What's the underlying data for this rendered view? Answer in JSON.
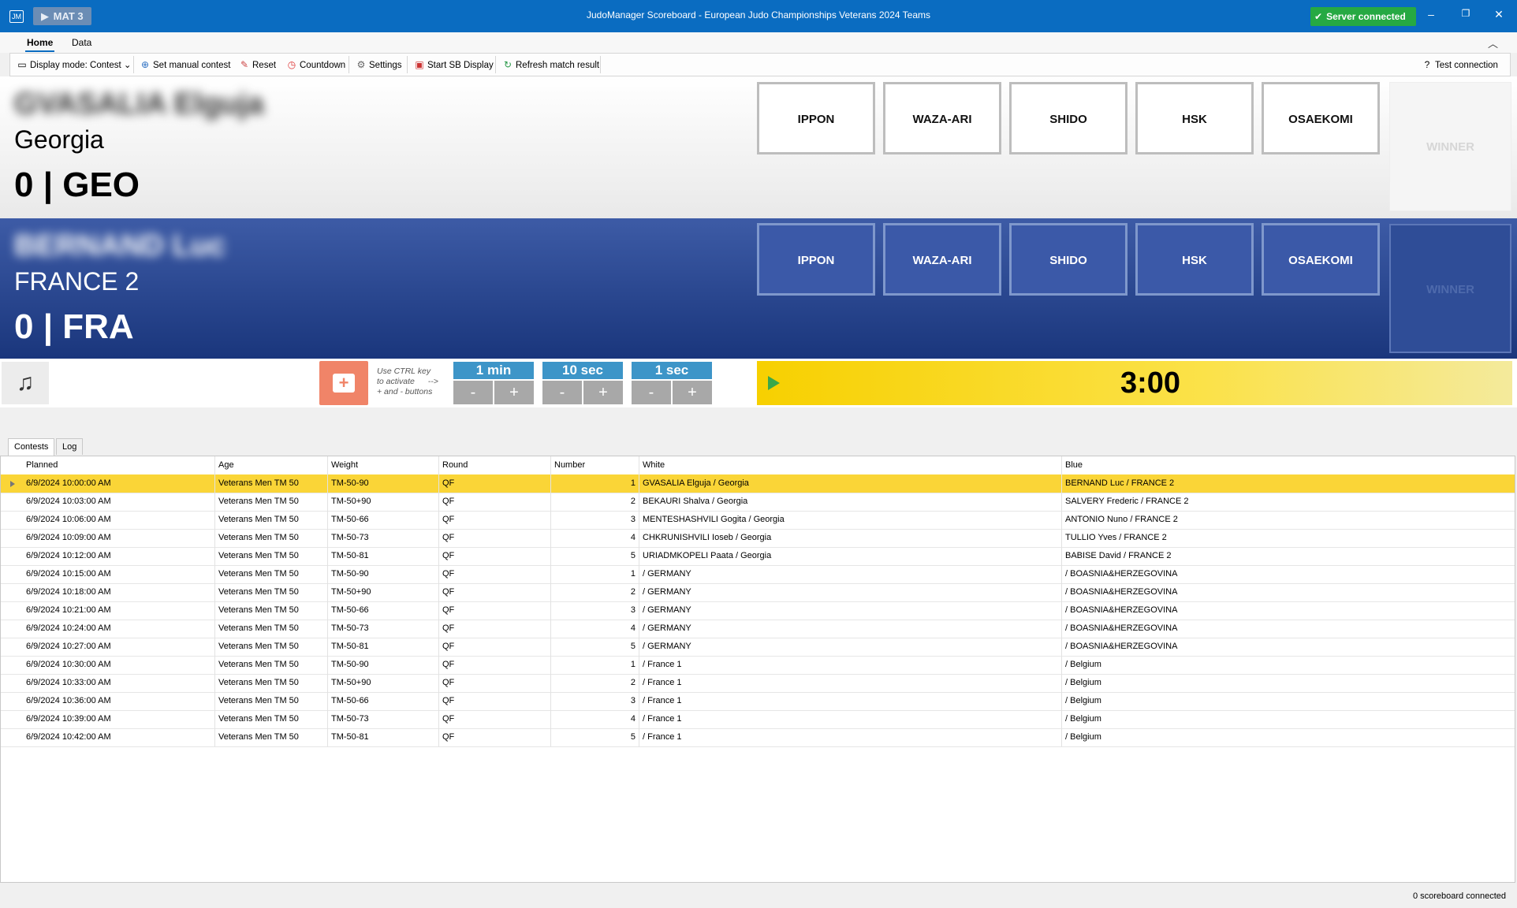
{
  "titlebar": {
    "app_icon": "JM",
    "mat_label": "MAT 3",
    "title": "JudoManager Scoreboard - European Judo Championships Veterans 2024 Teams",
    "server_status": "Server connected",
    "minimize": "–",
    "restore": "❐",
    "close": "✕"
  },
  "ribbon": {
    "tabs": [
      "Home",
      "Data"
    ],
    "collapse": "︿"
  },
  "toolbar": {
    "display_mode": "Display mode: Contest",
    "set_manual_contest": "Set manual contest",
    "reset": "Reset",
    "countdown": "Countdown",
    "settings": "Settings",
    "start_sb_display": "Start SB Display",
    "refresh_match_result": "Refresh match result",
    "test_connection": "Test connection"
  },
  "white": {
    "name": "GVASALIA Elguja",
    "country": "Georgia",
    "score": "0 | GEO",
    "buttons": [
      "IPPON",
      "WAZA-ARI",
      "SHIDO",
      "HSK",
      "OSAEKOMI"
    ],
    "winner": "WINNER"
  },
  "blue": {
    "name": "BERNAND Luc",
    "country": "FRANCE 2",
    "score": "0 | FRA",
    "buttons": [
      "IPPON",
      "WAZA-ARI",
      "SHIDO",
      "HSK",
      "OSAEKOMI"
    ],
    "winner": "WINNER"
  },
  "timer": {
    "music_icon": "♫",
    "ctrl_note": [
      "Use CTRL key",
      "to activate",
      "+ and - buttons",
      "-->"
    ],
    "increments": [
      "1 min",
      "10 sec",
      "1 sec"
    ],
    "minus": "-",
    "plus": "+",
    "time": "3:00"
  },
  "grid_tabs": [
    "Contests",
    "Log"
  ],
  "columns": [
    "Planned",
    "Age",
    "Weight",
    "Round",
    "Number",
    "White",
    "Blue"
  ],
  "rows": [
    [
      "6/9/2024 10:00:00 AM",
      "Veterans Men  TM 50",
      "TM-50-90",
      "QF",
      "1",
      "GVASALIA Elguja / Georgia",
      "BERNAND Luc / FRANCE 2"
    ],
    [
      "6/9/2024 10:03:00 AM",
      "Veterans Men  TM 50",
      "TM-50+90",
      "QF",
      "2",
      "BEKAURI Shalva / Georgia",
      "SALVERY Frederic / FRANCE 2"
    ],
    [
      "6/9/2024 10:06:00 AM",
      "Veterans Men  TM 50",
      "TM-50-66",
      "QF",
      "3",
      "MENTESHASHVILI Gogita / Georgia",
      "ANTONIO Nuno / FRANCE 2"
    ],
    [
      "6/9/2024 10:09:00 AM",
      "Veterans Men  TM 50",
      "TM-50-73",
      "QF",
      "4",
      "CHKRUNISHVILI Ioseb / Georgia",
      "TULLIO Yves / FRANCE 2"
    ],
    [
      "6/9/2024 10:12:00 AM",
      "Veterans Men  TM 50",
      "TM-50-81",
      "QF",
      "5",
      "URIADMKOPELI Paata / Georgia",
      "BABISE David / FRANCE 2"
    ],
    [
      "6/9/2024 10:15:00 AM",
      "Veterans Men  TM 50",
      "TM-50-90",
      "QF",
      "1",
      " / GERMANY",
      " / BOASNIA&HERZEGOVINA"
    ],
    [
      "6/9/2024 10:18:00 AM",
      "Veterans Men  TM 50",
      "TM-50+90",
      "QF",
      "2",
      " / GERMANY",
      " / BOASNIA&HERZEGOVINA"
    ],
    [
      "6/9/2024 10:21:00 AM",
      "Veterans Men  TM 50",
      "TM-50-66",
      "QF",
      "3",
      " / GERMANY",
      " / BOASNIA&HERZEGOVINA"
    ],
    [
      "6/9/2024 10:24:00 AM",
      "Veterans Men  TM 50",
      "TM-50-73",
      "QF",
      "4",
      " / GERMANY",
      " / BOASNIA&HERZEGOVINA"
    ],
    [
      "6/9/2024 10:27:00 AM",
      "Veterans Men  TM 50",
      "TM-50-81",
      "QF",
      "5",
      " / GERMANY",
      " / BOASNIA&HERZEGOVINA"
    ],
    [
      "6/9/2024 10:30:00 AM",
      "Veterans Men  TM 50",
      "TM-50-90",
      "QF",
      "1",
      " / France 1",
      " / Belgium"
    ],
    [
      "6/9/2024 10:33:00 AM",
      "Veterans Men  TM 50",
      "TM-50+90",
      "QF",
      "2",
      " / France 1",
      " / Belgium"
    ],
    [
      "6/9/2024 10:36:00 AM",
      "Veterans Men  TM 50",
      "TM-50-66",
      "QF",
      "3",
      " / France 1",
      " / Belgium"
    ],
    [
      "6/9/2024 10:39:00 AM",
      "Veterans Men  TM 50",
      "TM-50-73",
      "QF",
      "4",
      " / France 1",
      " / Belgium"
    ],
    [
      "6/9/2024 10:42:00 AM",
      "Veterans Men  TM 50",
      "TM-50-81",
      "QF",
      "5",
      " / France 1",
      " / Belgium"
    ]
  ],
  "status": "0 scoreboard connected",
  "colors": {
    "titlebar": "#0a6cc1",
    "server_ok": "#26a943",
    "blue_panel": "#2a4894",
    "selected_row": "#fad537",
    "clock": "#f7d000"
  }
}
